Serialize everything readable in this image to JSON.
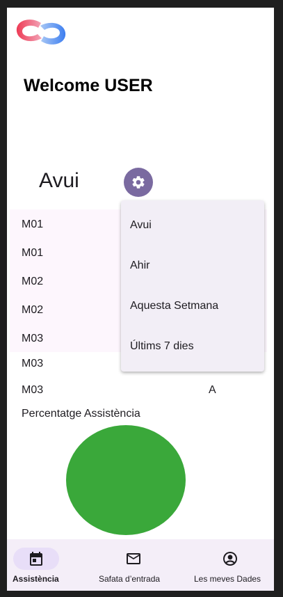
{
  "header": {
    "welcome": "Welcome USER"
  },
  "filter": {
    "current": "Avui"
  },
  "attendance": [
    {
      "module": "M01",
      "status": ""
    },
    {
      "module": "M01",
      "status": ""
    },
    {
      "module": "M02",
      "status": ""
    },
    {
      "module": "M02",
      "status": ""
    },
    {
      "module": "M03",
      "status": ""
    },
    {
      "module": "M03",
      "status": ""
    },
    {
      "module": "M03",
      "status": "A"
    }
  ],
  "percent_label": "Percentatge Assistència",
  "pie_color": "#3aa83a",
  "menu": {
    "items": [
      "Avui",
      "Ahir",
      "Aquesta Setmana",
      "Últims 7 dies"
    ]
  },
  "nav": {
    "items": [
      {
        "label": "Assistència",
        "icon": "calendar-icon",
        "active": true
      },
      {
        "label": "Safata d’entrada",
        "icon": "mail-icon",
        "active": false
      },
      {
        "label": "Les meves Dades",
        "icon": "account-circle-icon",
        "active": false
      }
    ]
  },
  "colors": {
    "accent": "#7a6aa0",
    "nav_bg": "#f4eef8",
    "active_pill": "#e8def8",
    "menu_bg": "#f2eef6"
  }
}
